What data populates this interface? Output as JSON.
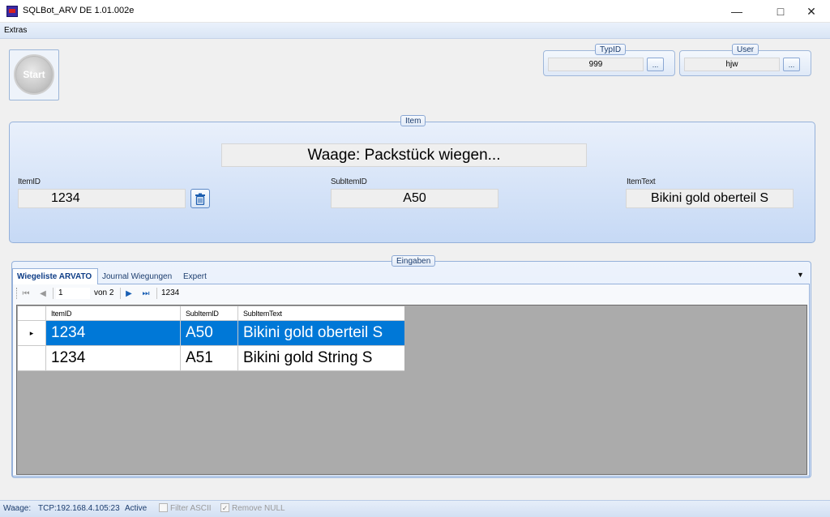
{
  "window": {
    "title": "SQLBot_ARV  DE 1.01.002e"
  },
  "menu": {
    "extras": "Extras"
  },
  "start": {
    "label": "Start"
  },
  "typid": {
    "title": "TypID",
    "value": "999",
    "button": "..."
  },
  "user": {
    "title": "User",
    "value": "hjw",
    "button": "..."
  },
  "item": {
    "group_title": "Item",
    "message": "Waage: Packstück wiegen...",
    "itemid_label": "ItemID",
    "itemid_value": "1234",
    "subitemid_label": "SubItemID",
    "subitemid_value": "A50",
    "itemtext_label": "ItemText",
    "itemtext_value": "Bikini gold oberteil S"
  },
  "eingaben": {
    "group_title": "Eingaben",
    "tabs": [
      {
        "label": "Wiegeliste ARVATO",
        "active": true
      },
      {
        "label": "Journal Wiegungen"
      },
      {
        "label": "Expert"
      }
    ],
    "navigator": {
      "position": "1",
      "of_text": "von 2",
      "extra": "1234"
    },
    "grid": {
      "columns": [
        "ItemID",
        "SubItemID",
        "SubItemText"
      ],
      "rows": [
        {
          "itemid": "1234",
          "subitemid": "A50",
          "text": "Bikini gold oberteil S",
          "selected": true
        },
        {
          "itemid": "1234",
          "subitemid": "A51",
          "text": "Bikini gold String S"
        }
      ]
    }
  },
  "status": {
    "waage": "Waage:",
    "tcp": "TCP:192.168.4.105:23",
    "state": "Active",
    "filter_ascii": "Filter ASCII",
    "remove_null": "Remove NULL",
    "remove_null_checked": true
  },
  "colors": {
    "selection": "#0078d7",
    "panel": "#c6d9f5",
    "grid_bg": "#ababab"
  }
}
